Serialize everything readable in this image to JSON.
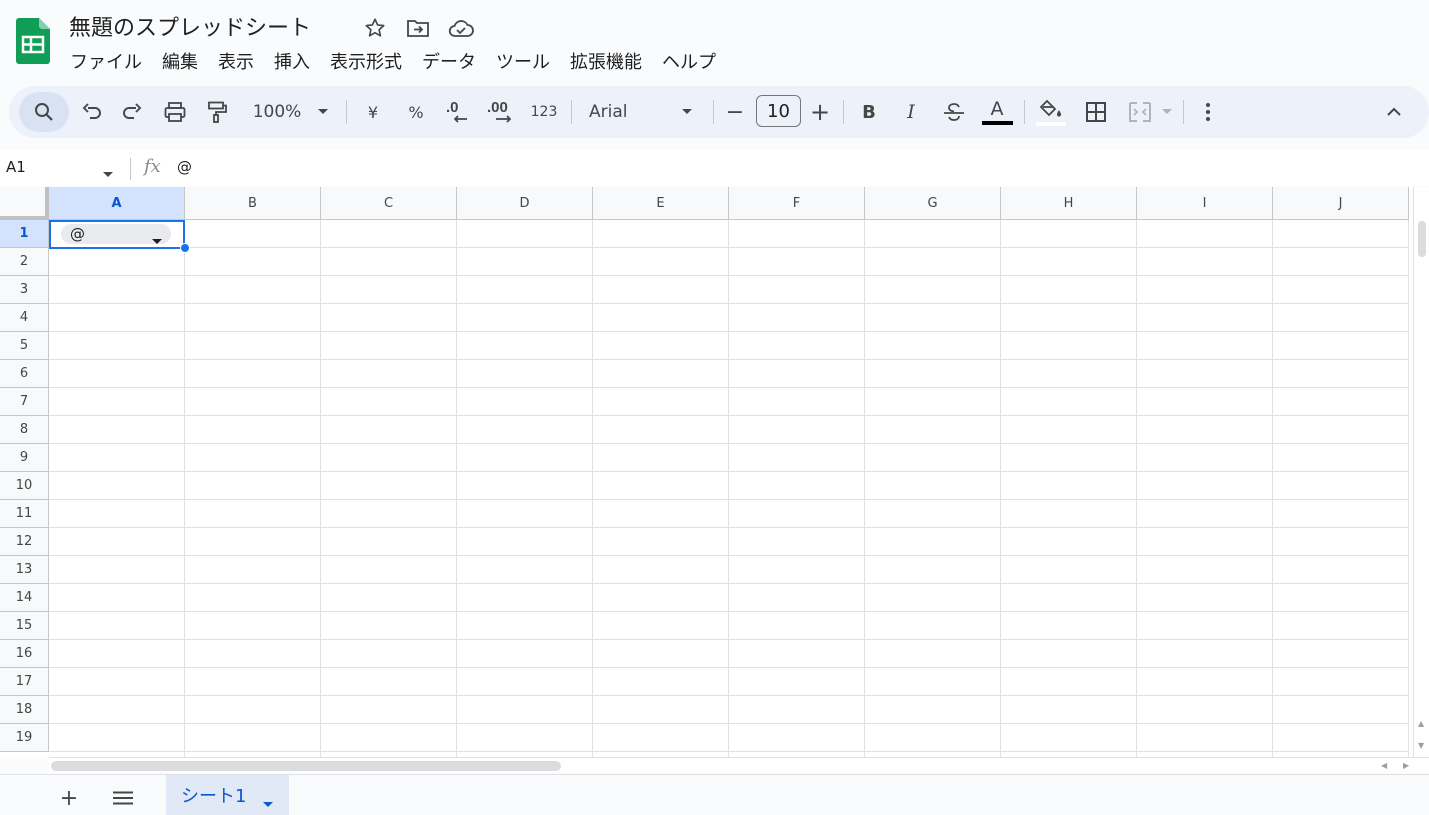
{
  "document": {
    "title": "無題のスプレッドシート",
    "icons": [
      "star-icon",
      "move-to-folder-icon",
      "cloud-saved-icon"
    ]
  },
  "menu": {
    "items": [
      "ファイル",
      "編集",
      "表示",
      "挿入",
      "表示形式",
      "データ",
      "ツール",
      "拡張機能",
      "ヘルプ"
    ]
  },
  "toolbar": {
    "zoom": "100%",
    "currency": "¥",
    "percent": "%",
    "decrease_decimal": ".0",
    "increase_decimal": ".00",
    "format_123": "123",
    "font": "Arial",
    "minus": "−",
    "font_size": "10",
    "plus": "+",
    "bold": "B",
    "italic": "I",
    "text_color_letter": "A"
  },
  "formula_bar": {
    "name_box": "A1",
    "fx": "fx",
    "value": "@"
  },
  "grid": {
    "columns": [
      "A",
      "B",
      "C",
      "D",
      "E",
      "F",
      "G",
      "H",
      "I",
      "J"
    ],
    "rows": [
      "1",
      "2",
      "3",
      "4",
      "5",
      "6",
      "7",
      "8",
      "9",
      "10",
      "11",
      "12",
      "13",
      "14",
      "15",
      "16",
      "17",
      "18",
      "19"
    ],
    "selected_column": "A",
    "selected_row": "1",
    "cell_A1_chip": "@"
  },
  "bottom": {
    "add_sheet": "+",
    "sheet_name": "シート1"
  },
  "colors": {
    "accent_blue": "#1a73e8",
    "sheets_green": "#0f9d58",
    "selected_header": "#d3e3fd"
  }
}
